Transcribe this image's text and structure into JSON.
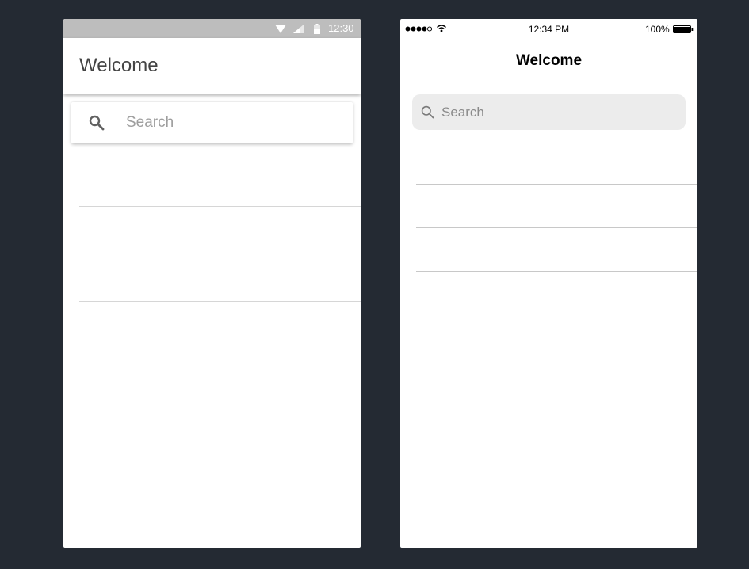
{
  "android": {
    "status_bar": {
      "time": "12:30",
      "icons": [
        "wifi-icon",
        "signal-icon",
        "battery-icon"
      ],
      "background": "#bdbdbd"
    },
    "app_bar": {
      "title": "Welcome"
    },
    "search": {
      "icon": "search-icon",
      "placeholder": "Search"
    },
    "list_rows": 4
  },
  "ios": {
    "status_bar": {
      "signal_dots": "●●●●○",
      "time": "12:34 PM",
      "battery_percent": "100%",
      "icons": [
        "signal-dots-icon",
        "wifi-icon",
        "battery-icon"
      ]
    },
    "nav_bar": {
      "title": "Welcome"
    },
    "search": {
      "icon": "search-icon",
      "placeholder": "Search",
      "background": "#ececec"
    },
    "list_rows": 4
  },
  "colors": {
    "background": "#242a33",
    "screen": "#ffffff",
    "divider": "#d6d6d6"
  }
}
